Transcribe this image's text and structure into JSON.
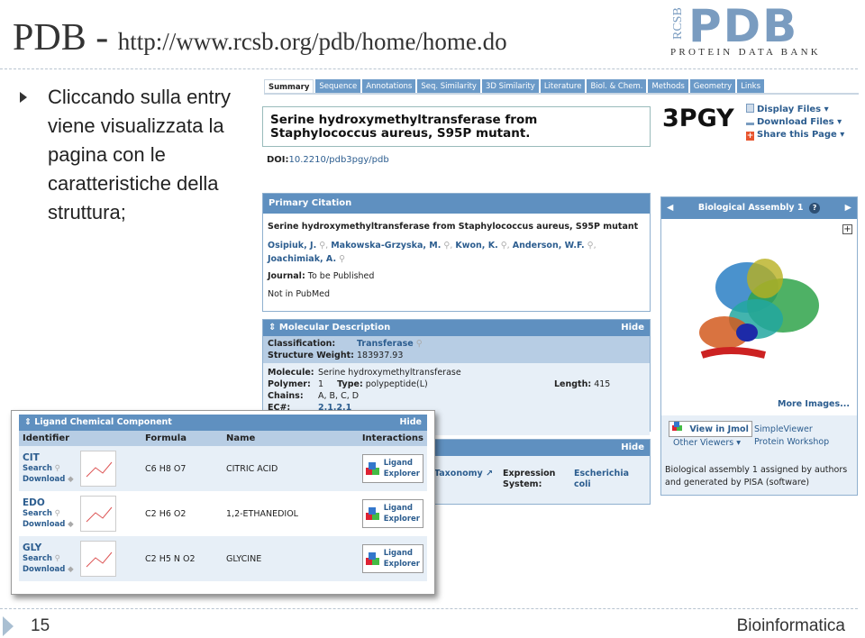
{
  "slide": {
    "title_main": "PDB - ",
    "title_url": "http://www.rcsb.org/pdb/home/home.do",
    "logo": {
      "rcsb": "RCSB",
      "pdb": "PDB",
      "subtitle": "PROTEIN DATA BANK",
      "color": "#7a9cc0"
    },
    "bullet": "Cliccando sulla entry viene visualizzata la pagina con le caratteristiche della struttura;",
    "page_number": "15",
    "footer": "Bioinformatica"
  },
  "tabs": [
    "Summary",
    "Sequence",
    "Annotations",
    "Seq. Similarity",
    "3D Similarity",
    "Literature",
    "Biol. & Chem.",
    "Methods",
    "Geometry",
    "Links"
  ],
  "entry": {
    "title": "Serine hydroxymethyltransferase from Staphylococcus aureus, S95P mutant.",
    "id": "3PGY",
    "file_links": [
      "Display Files",
      "Download Files",
      "Share this Page"
    ],
    "doi_label": "DOI:",
    "doi": "10.2210/pdb3pgy/pdb"
  },
  "citation": {
    "header": "Primary Citation",
    "title": "Serine hydroxymethyltransferase from Staphylococcus aureus, S95P mutant",
    "authors": [
      "Osipiuk, J.",
      "Makowska-Grzyska, M.",
      "Kwon, K.",
      "Anderson, W.F.",
      "Joachimiak, A."
    ],
    "journal_label": "Journal:",
    "journal": "To be Published",
    "pubmed": "Not in PubMed"
  },
  "molecular": {
    "header": "Molecular Description",
    "hide": "Hide",
    "classification_label": "Classification:",
    "classification": "Transferase",
    "weight_label": "Structure Weight:",
    "weight": "183937.93",
    "molecule_label": "Molecule:",
    "molecule": "Serine hydroxymethyltransferase",
    "polymer_label": "Polymer:",
    "polymer": "1",
    "type_label": "Type:",
    "type": "polypeptide(L)",
    "length_label": "Length:",
    "length": "415",
    "chains_label": "Chains:",
    "chains": "A, B, C, D",
    "ec_label": "EC#:",
    "ec": "2.1.2.1"
  },
  "source": {
    "hide": "Hide",
    "taxonomy": "Taxonomy",
    "expression_label": "Expression System:",
    "expression": "Escherichia coli"
  },
  "assembly": {
    "header": "Biological Assembly 1",
    "help": "?",
    "more_images": "More Images...",
    "jmol": "View in Jmol",
    "other_viewers": "Other Viewers",
    "simple_viewer": "SimpleViewer",
    "protein_workshop": "Protein Workshop",
    "note": "Biological assembly 1 assigned by authors and generated by PISA (software)"
  },
  "ligand": {
    "header": "Ligand Chemical Component",
    "hide": "Hide",
    "columns": [
      "Identifier",
      "Formula",
      "Name",
      "Interactions"
    ],
    "search": "Search",
    "download": "Download",
    "button": [
      "Ligand",
      "Explorer"
    ],
    "rows": [
      {
        "id": "CIT",
        "formula": "C6 H8 O7",
        "name": "CITRIC ACID"
      },
      {
        "id": "EDO",
        "formula": "C2 H6 O2",
        "name": "1,2-ETHANEDIOL"
      },
      {
        "id": "GLY",
        "formula": "C2 H5 N O2",
        "name": "GLYCINE"
      }
    ]
  }
}
